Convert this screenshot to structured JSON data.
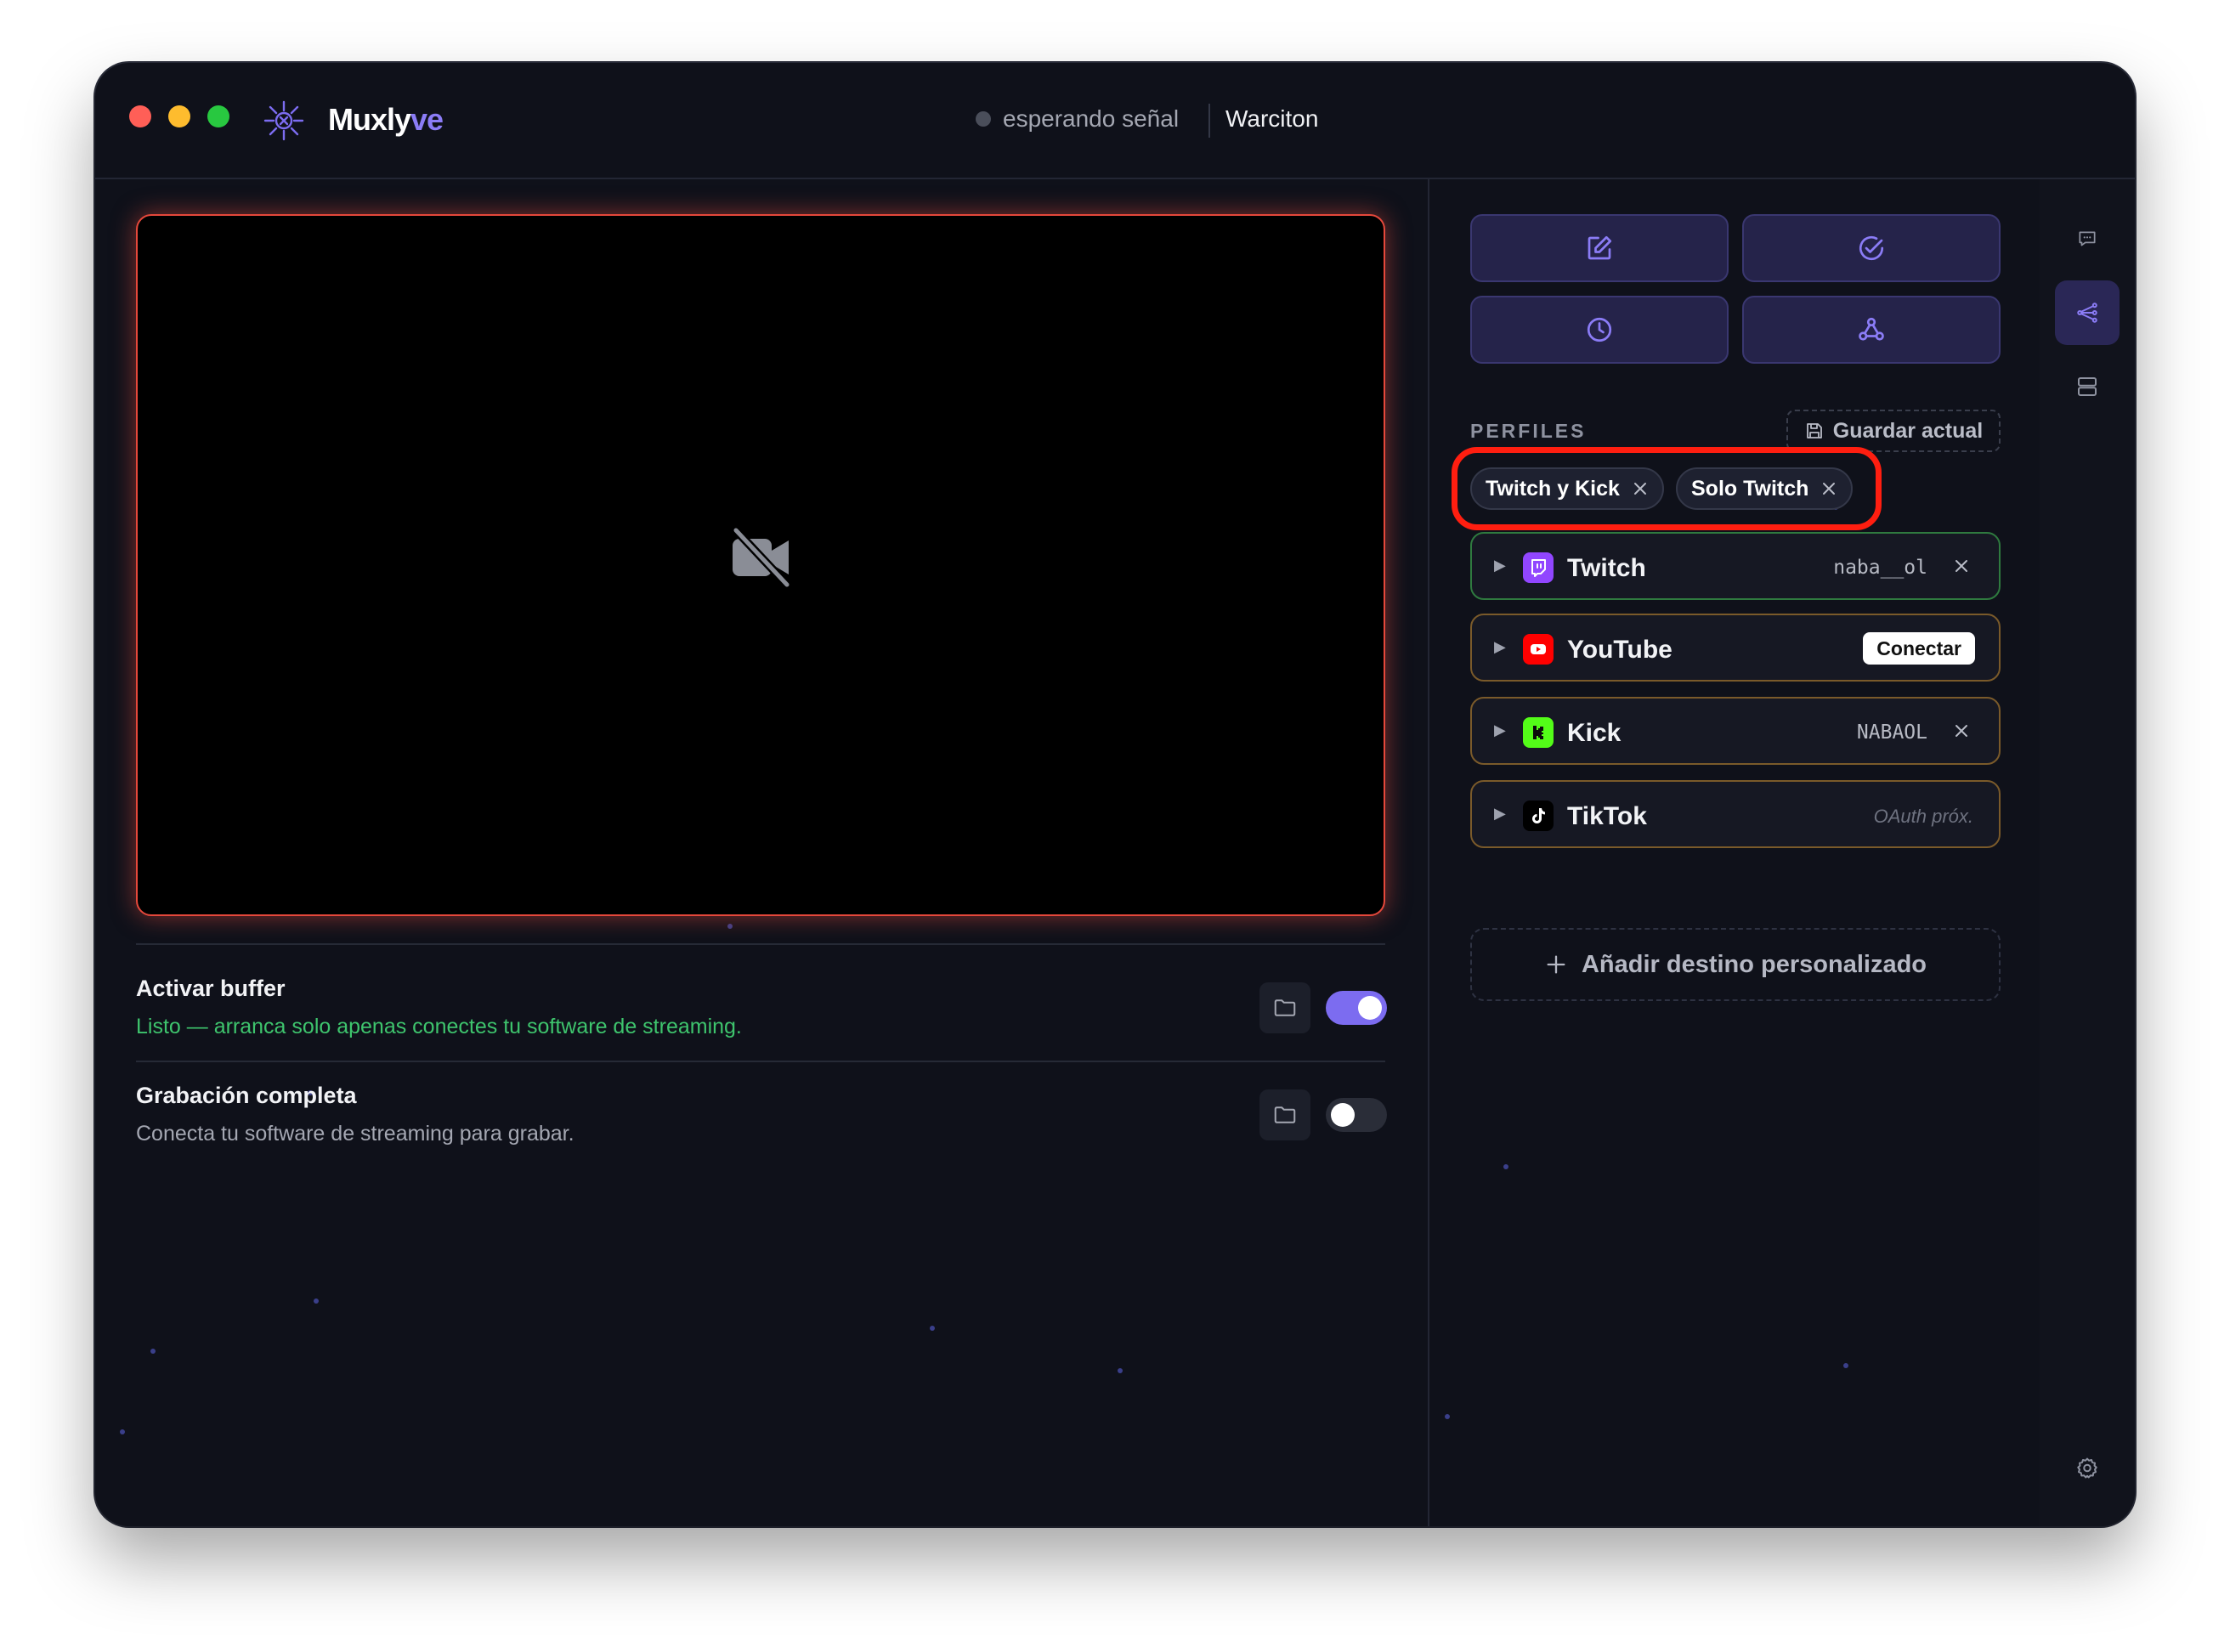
{
  "app": {
    "name_main": "Muxly",
    "name_accent": "ve",
    "status_text": "esperando señal",
    "user_name": "Warciton"
  },
  "buffer": {
    "title": "Activar buffer",
    "subtitle": "Listo — arranca solo apenas conectes tu software de streaming.",
    "enabled": true
  },
  "recording": {
    "title": "Grabación completa",
    "subtitle": "Conecta tu software de streaming para grabar.",
    "enabled": false
  },
  "toolbar": {
    "buttons": [
      "edit-icon",
      "check-circle-icon",
      "clock-icon",
      "webhook-icon"
    ]
  },
  "profiles": {
    "section_label": "PERFILES",
    "save_label": "Guardar actual",
    "chips": [
      "Twitch y Kick",
      "Solo Twitch"
    ]
  },
  "destinations": [
    {
      "name": "Twitch",
      "account": "naba__ol",
      "status": "connected"
    },
    {
      "name": "YouTube",
      "action": "Conectar",
      "status": "disconnected"
    },
    {
      "name": "Kick",
      "account": "NABAOL",
      "status": "connected"
    },
    {
      "name": "TikTok",
      "note": "OAuth próx.",
      "status": "unavailable"
    }
  ],
  "add_destination_label": "Añadir destino personalizado",
  "colors": {
    "accent": "#8b7cf6",
    "twitch": "#9146ff",
    "youtube": "#ff0000",
    "kick": "#53fc18",
    "status_green": "#3ec46d",
    "live_border": "#e5483b"
  }
}
